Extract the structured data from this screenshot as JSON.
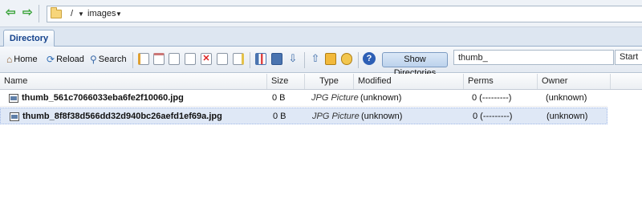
{
  "address_bar": {
    "back_icon": "back-arrow-icon",
    "forward_icon": "forward-arrow-icon",
    "root": "/",
    "current": "images"
  },
  "tabs": [
    {
      "label": "Directory"
    }
  ],
  "toolbar": {
    "home_label": "Home",
    "reload_label": "Reload",
    "search_label": "Search",
    "show_directories_label": "Show Directories",
    "filter_value": "thumb_",
    "start_label": "Start"
  },
  "columns": [
    "Name",
    "Size",
    "Type",
    "Modified",
    "Perms",
    "Owner"
  ],
  "files": [
    {
      "name": "thumb_561c7066033eba6fe2f10060.jpg",
      "size": "0 B",
      "type": "JPG Picture",
      "modified": "(unknown)",
      "perms": "0 (---------)",
      "owner": "(unknown)"
    },
    {
      "name": "thumb_8f8f38d566dd32d940bc26aefd1ef69a.jpg",
      "size": "0 B",
      "type": "JPG Picture",
      "modified": "(unknown)",
      "perms": "0 (---------)",
      "owner": "(unknown)"
    }
  ],
  "colors": {
    "tab_text": "#15428b",
    "selection": "#dfe8f6",
    "arrow": "#3aa33a"
  }
}
